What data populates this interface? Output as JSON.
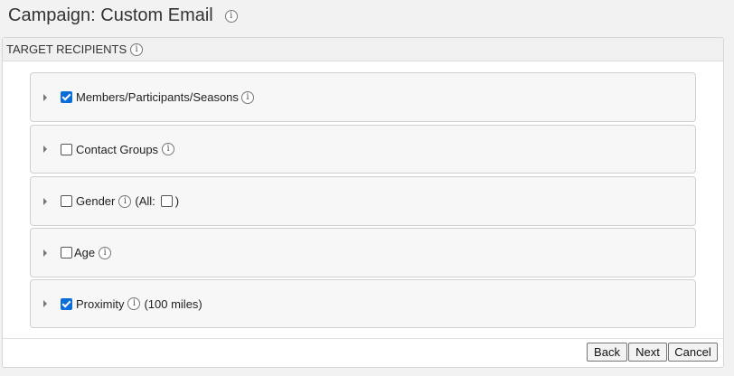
{
  "page": {
    "title": "Campaign: Custom Email"
  },
  "panel": {
    "header": "TARGET RECIPIENTS"
  },
  "sections": [
    {
      "label": "Members/Participants/Seasons",
      "checked": true
    },
    {
      "label": "Contact Groups",
      "checked": false
    },
    {
      "label": "Gender",
      "checked": false,
      "extra_prefix": "(All:",
      "extra_suffix": ")",
      "all_checked": false
    },
    {
      "label": "Age",
      "checked": false
    },
    {
      "label": "Proximity",
      "checked": true,
      "extra_text": "(100 miles)"
    }
  ],
  "buttons": {
    "back": "Back",
    "next": "Next",
    "cancel": "Cancel"
  },
  "icons": {
    "info": "ⓘ"
  },
  "colors": {
    "checkbox_checked": "#0b6ed8"
  }
}
